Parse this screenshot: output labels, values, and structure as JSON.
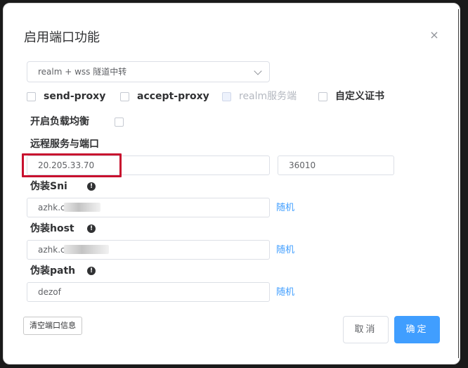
{
  "dialog": {
    "title": "启用端口功能",
    "close_icon": "×"
  },
  "mode_select": {
    "value": "realm + wss 隧道中转"
  },
  "options": [
    {
      "label": "send-proxy",
      "checked": false,
      "disabled": false
    },
    {
      "label": "accept-proxy",
      "checked": false,
      "disabled": false
    },
    {
      "label": "realm服务端",
      "checked": false,
      "disabled": true
    },
    {
      "label": "自定义证书",
      "checked": false,
      "disabled": false
    }
  ],
  "load_balance": {
    "label": "开启负载均衡"
  },
  "remote": {
    "label": "远程服务与端口",
    "host": "20.205.33.70",
    "port": "36010"
  },
  "fake_sni": {
    "label": "伪装Sni",
    "value": "azhk.c",
    "random_label": "随机"
  },
  "fake_host": {
    "label": "伪装host",
    "value": "azhk.c",
    "random_label": "随机"
  },
  "fake_path": {
    "label": "伪装path",
    "value": "dezof",
    "random_label": "随机"
  },
  "buttons": {
    "clear": "清空端口信息",
    "cancel": "取消",
    "confirm": "确定"
  },
  "info_icon_glyph": "!"
}
